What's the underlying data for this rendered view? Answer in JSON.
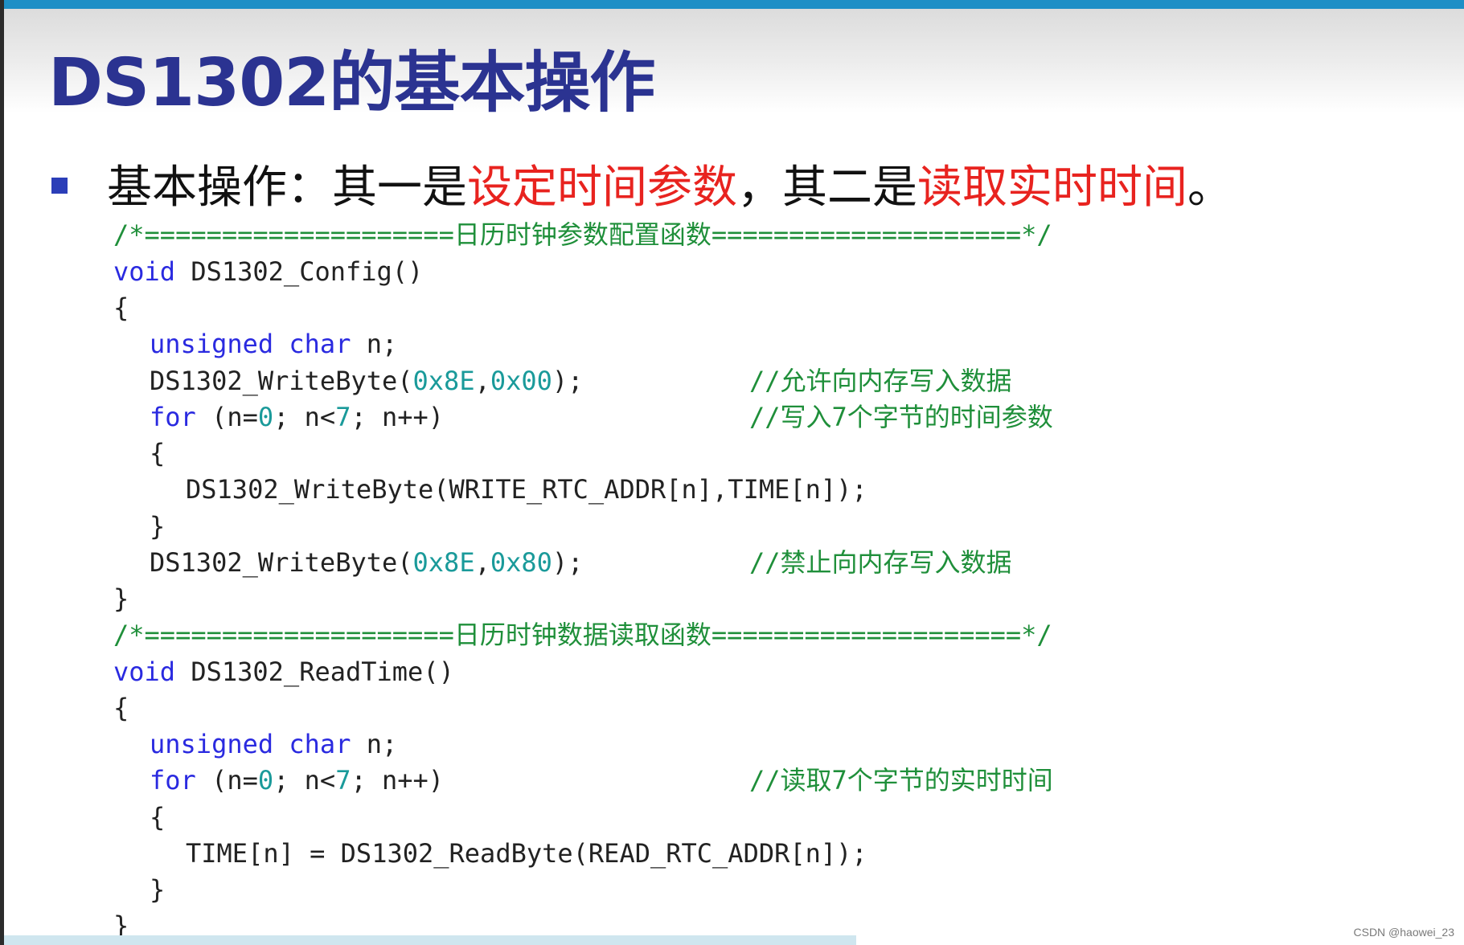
{
  "slide": {
    "title": "DS1302的基本操作",
    "bullet": {
      "p1": "基本操作：其一是",
      "h1": "设定时间参数",
      "p2": "，其二是",
      "h2": "读取实时时间",
      "p3": "。"
    }
  },
  "code": {
    "config_header": "/*====================日历时钟参数配置函数====================*/",
    "config_sig": {
      "kw": "void",
      "name": " DS1302_Config()"
    },
    "brace_open": "{",
    "brace_close": "}",
    "config_decl": {
      "kw1": "unsigned",
      "kw2": "char",
      "rest": " n;"
    },
    "wb1": {
      "pre": "DS1302_WriteByte(",
      "a": "0x8E",
      "sep": ",",
      "b": "0x00",
      "post": ");"
    },
    "wb1_comment": "//允许向内存写入数据",
    "for1": {
      "kw": "for",
      "p1": " (n=",
      "n0": "0",
      "p2": "; n<",
      "n7": "7",
      "p3": "; n++)"
    },
    "for1_comment": "//写入7个字节的时间参数",
    "wb_loop": "DS1302_WriteByte(WRITE_RTC_ADDR[n],TIME[n]);",
    "wb2": {
      "pre": "DS1302_WriteByte(",
      "a": "0x8E",
      "sep": ",",
      "b": "0x80",
      "post": ");"
    },
    "wb2_comment": "//禁止向内存写入数据",
    "read_header": "/*====================日历时钟数据读取函数====================*/",
    "read_sig": {
      "kw": "void",
      "name": " DS1302_ReadTime()"
    },
    "read_decl": {
      "kw1": "unsigned",
      "kw2": "char",
      "rest": " n;"
    },
    "for2": {
      "kw": "for",
      "p1": " (n=",
      "n0": "0",
      "p2": "; n<",
      "n7": "7",
      "p3": "; n++)"
    },
    "for2_comment": "//读取7个字节的实时时间",
    "read_loop": "TIME[n] = DS1302_ReadByte(READ_RTC_ADDR[n]);"
  },
  "watermark": "CSDN @haowei_23",
  "colors": {
    "title": "#2b3391",
    "highlight": "#e8231f",
    "keyword": "#2a2ae0",
    "number": "#1a9a9a",
    "comment": "#1f8f3a",
    "top_bar": "#1e8fc6"
  }
}
